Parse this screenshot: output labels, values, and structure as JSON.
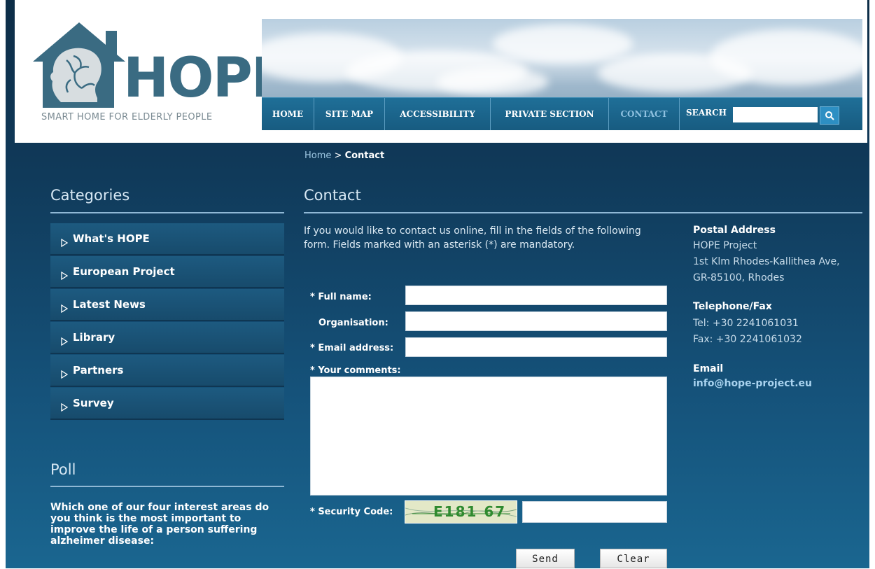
{
  "logo": {
    "word": "HOPE",
    "tagline": "SMART HOME FOR ELDERLY PEOPLE"
  },
  "nav": {
    "items": [
      {
        "label": "HOME"
      },
      {
        "label": "SITE MAP"
      },
      {
        "label": "ACCESSIBILITY"
      },
      {
        "label": "PRIVATE SECTION"
      },
      {
        "label": "CONTACT"
      }
    ],
    "search_label": "SEARCH",
    "search_value": ""
  },
  "breadcrumb": {
    "home": "Home",
    "separator": ">",
    "current": "Contact"
  },
  "sidebar": {
    "title": "Categories",
    "items": [
      {
        "label": "What's HOPE"
      },
      {
        "label": "European Project"
      },
      {
        "label": "Latest News"
      },
      {
        "label": "Library"
      },
      {
        "label": "Partners"
      },
      {
        "label": "Survey"
      }
    ],
    "poll": {
      "title": "Poll",
      "question": "Which one of our four interest areas do you think is the most important to improve the life of a person suffering alzheimer disease:"
    }
  },
  "main": {
    "title": "Contact",
    "intro": "If you would like to contact us online, fill in the fields of the following form. Fields marked with an asterisk (*) are mandatory.",
    "form": {
      "full_name_label": "* Full name:",
      "full_name_value": "",
      "organisation_label": "Organisation:",
      "organisation_value": "",
      "email_label": "* Email address:",
      "email_value": "",
      "comments_label": "* Your comments:",
      "comments_value": "",
      "security_label": "* Security Code:",
      "captcha_text": "E181 67",
      "security_value": "",
      "send_label": "Send",
      "clear_label": "Clear"
    }
  },
  "contact_info": {
    "postal_heading": "Postal Address",
    "postal_lines": [
      "HOPE Project",
      "1st Klm Rhodes-Kallithea Ave,",
      "GR-85100, Rhodes"
    ],
    "phone_heading": "Telephone/Fax",
    "phone_lines": [
      "Tel: +30 2241061031",
      "Fax: +30 2241061032"
    ],
    "email_heading": "Email",
    "email_address": "info@hope-project.eu"
  },
  "colors": {
    "background_top": "#0d2d47",
    "background_bottom": "#1a6690",
    "nav_bar": "#1f6f98",
    "active_nav": "#8fc1e0",
    "logo_blue": "#3a6b82",
    "link": "#a9d3ef"
  }
}
